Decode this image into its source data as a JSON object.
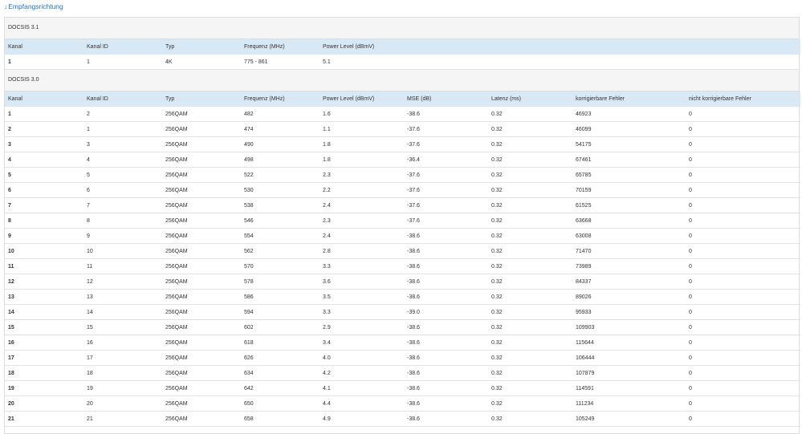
{
  "toggle": {
    "arrow": "↓",
    "label": "Empfangsrichtung"
  },
  "docsis31": {
    "title": "DOCSIS 3.1",
    "headers": [
      "Kanal",
      "Kanal ID",
      "Typ",
      "Frequenz (MHz)",
      "Power Level (dBmV)"
    ],
    "rows": [
      [
        "1",
        "1",
        "4K",
        "775 - 861",
        "5.1"
      ]
    ]
  },
  "docsis30": {
    "title": "DOCSIS 3.0",
    "headers": [
      "Kanal",
      "Kanal ID",
      "Typ",
      "Frequenz (MHz)",
      "Power Level (dBmV)",
      "MSE (dB)",
      "Latenz (ms)",
      "korrigierbare Fehler",
      "nicht korrigierbare Fehler"
    ],
    "rows": [
      [
        "1",
        "2",
        "256QAM",
        "482",
        "1.6",
        "-38.6",
        "0.32",
        "46923",
        "0"
      ],
      [
        "2",
        "1",
        "256QAM",
        "474",
        "1.1",
        "-37.6",
        "0.32",
        "46099",
        "0"
      ],
      [
        "3",
        "3",
        "256QAM",
        "490",
        "1.8",
        "-37.6",
        "0.32",
        "54175",
        "0"
      ],
      [
        "4",
        "4",
        "256QAM",
        "498",
        "1.8",
        "-36.4",
        "0.32",
        "67461",
        "0"
      ],
      [
        "5",
        "5",
        "256QAM",
        "522",
        "2.3",
        "-37.6",
        "0.32",
        "65785",
        "0"
      ],
      [
        "6",
        "6",
        "256QAM",
        "530",
        "2.2",
        "-37.6",
        "0.32",
        "70159",
        "0"
      ],
      [
        "7",
        "7",
        "256QAM",
        "538",
        "2.4",
        "-37.6",
        "0.32",
        "61525",
        "0"
      ],
      [
        "8",
        "8",
        "256QAM",
        "546",
        "2.3",
        "-37.6",
        "0.32",
        "63668",
        "0"
      ],
      [
        "9",
        "9",
        "256QAM",
        "554",
        "2.4",
        "-38.6",
        "0.32",
        "63008",
        "0"
      ],
      [
        "10",
        "10",
        "256QAM",
        "562",
        "2.8",
        "-38.6",
        "0.32",
        "71470",
        "0"
      ],
      [
        "11",
        "11",
        "256QAM",
        "570",
        "3.3",
        "-38.6",
        "0.32",
        "73989",
        "0"
      ],
      [
        "12",
        "12",
        "256QAM",
        "578",
        "3.6",
        "-38.6",
        "0.32",
        "84337",
        "0"
      ],
      [
        "13",
        "13",
        "256QAM",
        "586",
        "3.5",
        "-38.6",
        "0.32",
        "89026",
        "0"
      ],
      [
        "14",
        "14",
        "256QAM",
        "594",
        "3.3",
        "-39.0",
        "0.32",
        "95933",
        "0"
      ],
      [
        "15",
        "15",
        "256QAM",
        "602",
        "2.9",
        "-38.6",
        "0.32",
        "109903",
        "0"
      ],
      [
        "16",
        "16",
        "256QAM",
        "618",
        "3.4",
        "-38.6",
        "0.32",
        "115644",
        "0"
      ],
      [
        "17",
        "17",
        "256QAM",
        "626",
        "4.0",
        "-38.6",
        "0.32",
        "106444",
        "0"
      ],
      [
        "18",
        "18",
        "256QAM",
        "634",
        "4.2",
        "-38.6",
        "0.32",
        "107879",
        "0"
      ],
      [
        "19",
        "19",
        "256QAM",
        "642",
        "4.1",
        "-38.6",
        "0.32",
        "114591",
        "0"
      ],
      [
        "20",
        "20",
        "256QAM",
        "650",
        "4.4",
        "-38.6",
        "0.32",
        "111234",
        "0"
      ],
      [
        "21",
        "21",
        "256QAM",
        "658",
        "4.9",
        "-38.6",
        "0.32",
        "105249",
        "0"
      ]
    ]
  }
}
